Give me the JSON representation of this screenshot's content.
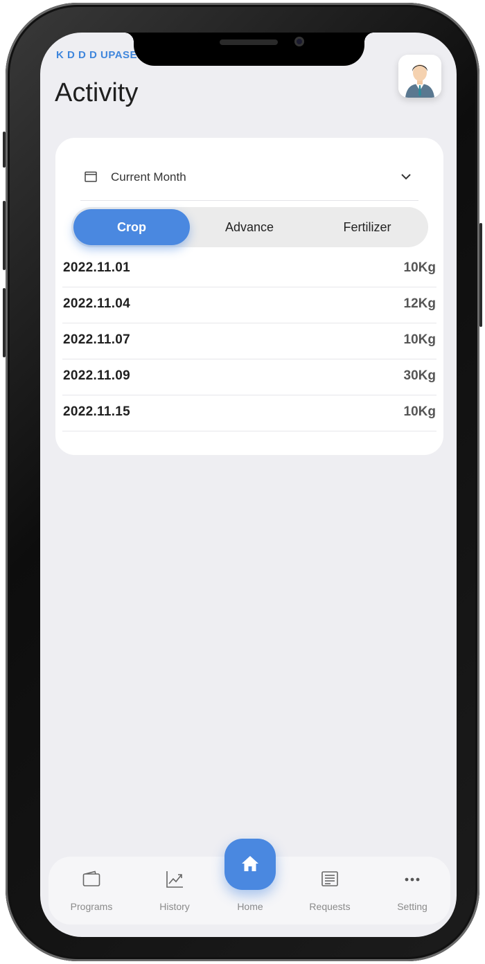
{
  "header": {
    "brand": "K D D D UPASEN",
    "title": "Activity"
  },
  "filter": {
    "period": "Current Month"
  },
  "tabs": [
    {
      "label": "Crop",
      "active": true
    },
    {
      "label": "Advance",
      "active": false
    },
    {
      "label": "Fertilizer",
      "active": false
    }
  ],
  "records": [
    {
      "date": "2022.11.01",
      "qty": "10Kg"
    },
    {
      "date": "2022.11.04",
      "qty": "12Kg"
    },
    {
      "date": "2022.11.07",
      "qty": "10Kg"
    },
    {
      "date": "2022.11.09",
      "qty": "30Kg"
    },
    {
      "date": "2022.11.15",
      "qty": "10Kg"
    }
  ],
  "nav": {
    "programs": "Programs",
    "history": "History",
    "home": "Home",
    "requests": "Requests",
    "setting": "Setting"
  },
  "colors": {
    "accent": "#4a88e0",
    "background": "#eeeef2"
  }
}
